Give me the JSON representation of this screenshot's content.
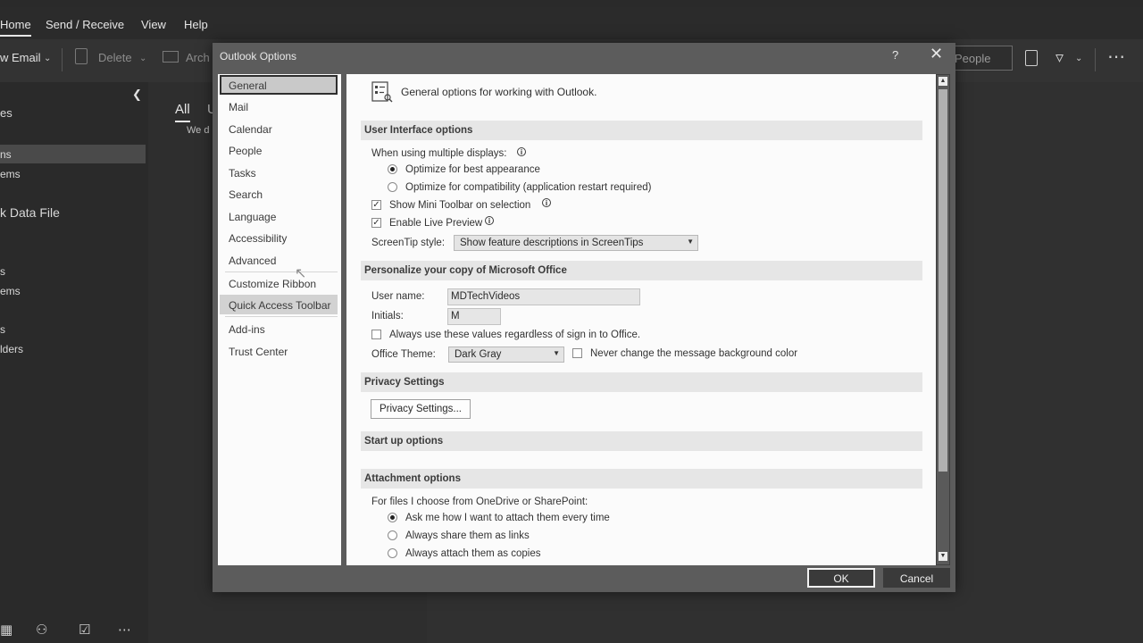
{
  "app": {
    "ribbon_tabs": [
      "Home",
      "Send / Receive",
      "View",
      "Help"
    ],
    "toolbar": {
      "new_email_label": "w Email",
      "delete_label": "Delete",
      "archive_label": "Arch",
      "people_placeholder": "People"
    },
    "folder_pane": {
      "items": [
        "es",
        "ns",
        "ems",
        "k Data File",
        "s",
        "ems",
        "s",
        "lders"
      ]
    },
    "mail_list": {
      "tab_all": "All",
      "tab_unread": "U",
      "notice": "We d"
    }
  },
  "dialog": {
    "title": "Outlook Options",
    "help_glyph": "?",
    "close_glyph": "✕",
    "nav_items": [
      "General",
      "Mail",
      "Calendar",
      "People",
      "Tasks",
      "Search",
      "Language",
      "Accessibility",
      "Advanced",
      "Customize Ribbon",
      "Quick Access Toolbar",
      "Add-ins",
      "Trust Center"
    ],
    "selected_nav": "General",
    "header": "General options for working with Outlook.",
    "sections": {
      "ui": "User Interface options",
      "personalize": "Personalize your copy of Microsoft Office",
      "privacy": "Privacy Settings",
      "startup": "Start up options",
      "attachment": "Attachment options"
    },
    "ui_options": {
      "multiple_displays_label": "When using multiple displays:",
      "radio_best": "Optimize for best appearance",
      "radio_compat": "Optimize for compatibility (application restart required)",
      "mini_toolbar": "Show Mini Toolbar on selection",
      "live_preview": "Enable Live Preview",
      "screentip_label": "ScreenTip style:",
      "screentip_value": "Show feature descriptions in ScreenTips"
    },
    "personalize": {
      "username_label": "User name:",
      "username_value": "MDTechVideos",
      "initials_label": "Initials:",
      "initials_value": "M",
      "always_use": "Always use these values regardless of sign in to Office.",
      "theme_label": "Office Theme:",
      "theme_value": "Dark Gray",
      "never_change": "Never change the message background color"
    },
    "privacy": {
      "button": "Privacy Settings..."
    },
    "attachment": {
      "label": "For files I choose from OneDrive or SharePoint:",
      "radio_ask": "Ask me how I want to attach them every time",
      "radio_links": "Always share them as links",
      "radio_copies": "Always attach them as copies"
    },
    "ok_label": "OK",
    "cancel_label": "Cancel"
  }
}
